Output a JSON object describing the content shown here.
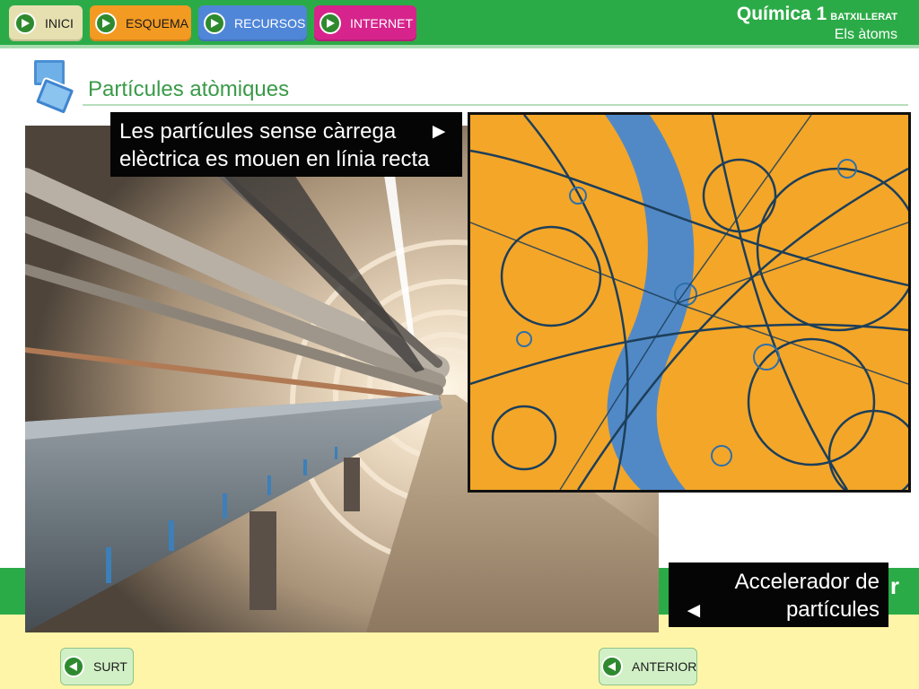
{
  "nav": {
    "buttons": [
      {
        "label": "INICI",
        "color": "#e6e0b0"
      },
      {
        "label": "ESQUEMA",
        "color": "#f39a22"
      },
      {
        "label": "RECURSOS",
        "color": "#4f86d8"
      },
      {
        "label": "INTERNET",
        "color": "#d6248c"
      }
    ]
  },
  "brand": {
    "title": "Química 1",
    "subtitle": "BATXILLERAT",
    "unit": "Els àtoms"
  },
  "page": {
    "title": "Partícules atòmiques"
  },
  "captions": {
    "top": {
      "line1": "Les partícules sense càrrega",
      "line2": "elèctrica es mouen en línia recta",
      "arrow": "►"
    },
    "bottom": {
      "line1": "Accelerador de",
      "line2": "partícules",
      "arrow": "◄"
    }
  },
  "band": {
    "text": "r"
  },
  "footer": {
    "exit_label": "SURT",
    "previous_label": "ANTERIOR"
  },
  "colors": {
    "top_bar": "#2bab47",
    "accent_green": "#3a9a48",
    "footer_band": "#fff5a8"
  },
  "icons": {
    "nav": "play-icon",
    "footer": "back-arrow-icon",
    "title": "slides-icon"
  }
}
